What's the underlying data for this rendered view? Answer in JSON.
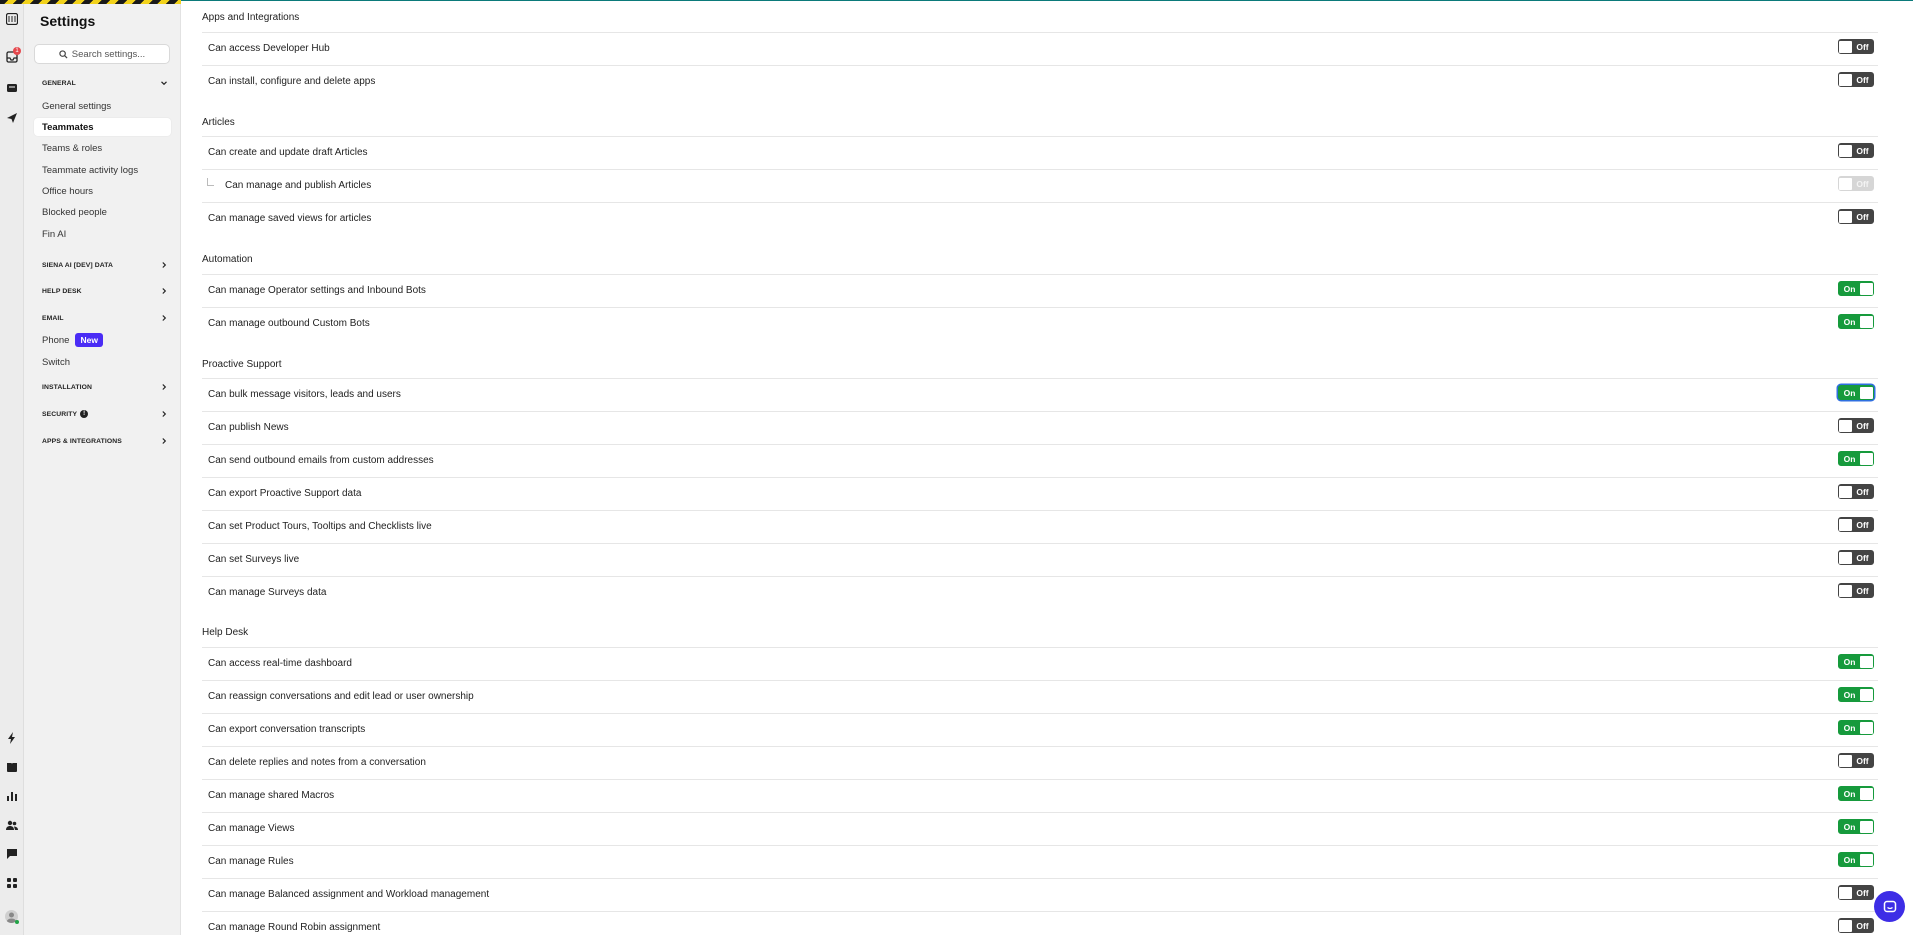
{
  "app": {
    "rail_icons_top": [
      "grid-logo-icon",
      "inbox-icon",
      "tickets-icon",
      "outbound-icon"
    ],
    "rail_icons_bottom": [
      "automation-icon",
      "knowledge-icon",
      "reports-icon",
      "contacts-icon",
      "messages-icon",
      "apps-icon"
    ],
    "inbox_badge": "1"
  },
  "sidebar": {
    "title": "Settings",
    "search_placeholder": "Search settings...",
    "general_header": "GENERAL",
    "general_items": [
      {
        "label": "General settings"
      },
      {
        "label": "Teammates",
        "active": true
      },
      {
        "label": "Teams & roles"
      },
      {
        "label": "Teammate activity logs"
      },
      {
        "label": "Office hours"
      },
      {
        "label": "Blocked people"
      },
      {
        "label": "Fin AI"
      }
    ],
    "siena_header": "SIENA AI [DEV] DATA",
    "helpdesk_header": "HELP DESK",
    "email_header": "EMAIL",
    "email_items": [
      {
        "label": "Phone",
        "badge": "New"
      },
      {
        "label": "Switch"
      }
    ],
    "installation_header": "INSTALLATION",
    "security_header": "SECURITY",
    "security_info": "!",
    "apps_header": "APPS & INTEGRATIONS"
  },
  "toggle_labels": {
    "on": "On",
    "off": "Off"
  },
  "permissions": {
    "apps": {
      "title": "Apps and Integrations",
      "rows": [
        {
          "label": "Can access Developer Hub",
          "state": "off"
        },
        {
          "label": "Can install, configure and delete apps",
          "state": "off"
        }
      ]
    },
    "articles": {
      "title": "Articles",
      "rows": [
        {
          "label": "Can create and update draft Articles",
          "state": "off"
        },
        {
          "label": "Can manage and publish Articles",
          "state": "off",
          "disabled": true,
          "sub": true
        },
        {
          "label": "Can manage saved views for articles",
          "state": "off"
        }
      ]
    },
    "automation": {
      "title": "Automation",
      "rows": [
        {
          "label": "Can manage Operator settings and Inbound Bots",
          "state": "on"
        },
        {
          "label": "Can manage outbound Custom Bots",
          "state": "on"
        }
      ]
    },
    "proactive": {
      "title": "Proactive Support",
      "rows": [
        {
          "label": "Can bulk message visitors, leads and users",
          "state": "on",
          "focus": true
        },
        {
          "label": "Can publish News",
          "state": "off"
        },
        {
          "label": "Can send outbound emails from custom addresses",
          "state": "on"
        },
        {
          "label": "Can export Proactive Support data",
          "state": "off"
        },
        {
          "label": "Can set Product Tours, Tooltips and Checklists live",
          "state": "off"
        },
        {
          "label": "Can set Surveys live",
          "state": "off"
        },
        {
          "label": "Can manage Surveys data",
          "state": "off"
        }
      ]
    },
    "helpdesk": {
      "title": "Help Desk",
      "rows": [
        {
          "label": "Can access real-time dashboard",
          "state": "on"
        },
        {
          "label": "Can reassign conversations and edit lead or user ownership",
          "state": "on"
        },
        {
          "label": "Can export conversation transcripts",
          "state": "on"
        },
        {
          "label": "Can delete replies and notes from a conversation",
          "state": "off"
        },
        {
          "label": "Can manage shared Macros",
          "state": "on"
        },
        {
          "label": "Can manage Views",
          "state": "on"
        },
        {
          "label": "Can manage Rules",
          "state": "on"
        },
        {
          "label": "Can manage Balanced assignment and Workload management",
          "state": "off"
        },
        {
          "label": "Can manage Round Robin assignment",
          "state": "off"
        }
      ]
    }
  },
  "colors": {
    "on": "#169a3c",
    "off": "#444444",
    "accent": "#4a2cf5"
  }
}
